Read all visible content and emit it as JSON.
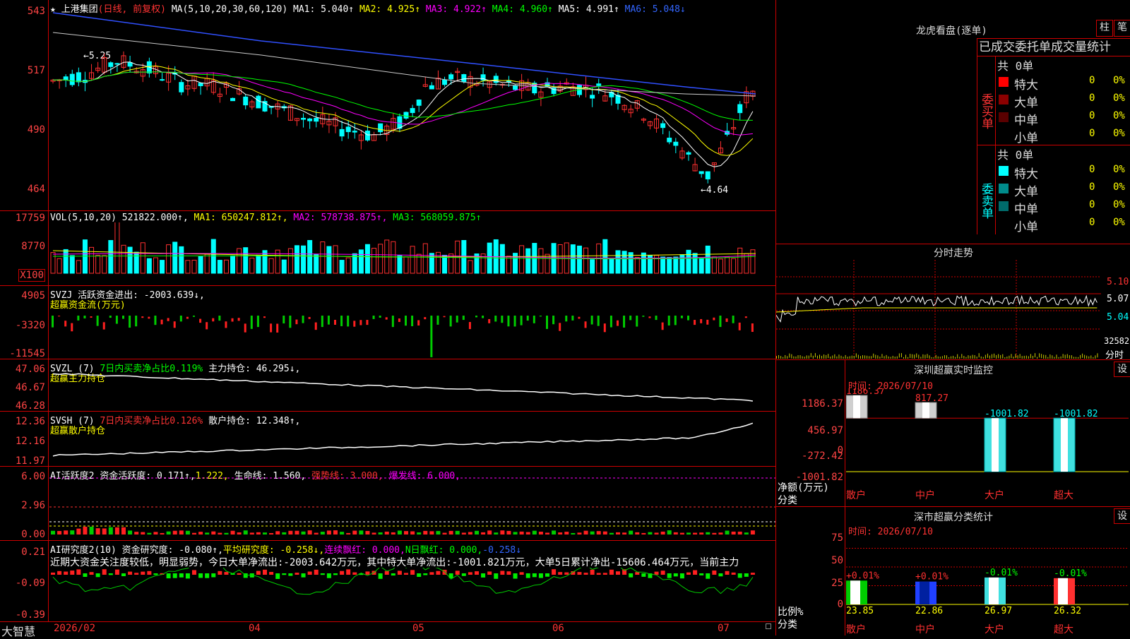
{
  "app": {
    "brand": "大智慧"
  },
  "kline": {
    "stock_name": "上港集团",
    "period_label": "(日线, 前复权)",
    "ma_params": "MA(5,10,20,30,60,120)",
    "ma_items": [
      {
        "label": "MA1: 5.040↑",
        "color": "#ffffff"
      },
      {
        "label": "MA2: 4.925↑",
        "color": "#ffff00"
      },
      {
        "label": "MA3: 4.922↑",
        "color": "#ff00ff"
      },
      {
        "label": "MA4: 4.960↑",
        "color": "#00ff00"
      },
      {
        "label": "MA5: 4.991↑",
        "color": "#ffffff"
      },
      {
        "label": "MA6: 5.048↓",
        "color": "#3366ff"
      }
    ],
    "y_ticks": [
      "543",
      "517",
      "490",
      "464"
    ],
    "high_marker": "←5.25",
    "low_marker": "←4.64"
  },
  "volume": {
    "header_name": "VOL(5,10,20)",
    "header_value": "521822.000↑,",
    "ma1": "MA1: 650247.812↑,",
    "ma2": "MA2: 578738.875↑,",
    "ma3": "MA3: 568059.875↑",
    "y_ticks": [
      "17759",
      "8770"
    ],
    "unit": "X100"
  },
  "svzj": {
    "header": "SVZJ  活跃资金进出: -2003.639↓,",
    "subtitle": "超赢资金流(万元)",
    "y_ticks": [
      "4905",
      "-3320",
      "-11545"
    ]
  },
  "svzl": {
    "name": "SVZL (7)",
    "ratio": "7日内买卖净占比0.119%",
    "hold": "主力持仓: 46.295↓,",
    "subtitle": "超赢主力持仓",
    "y_ticks": [
      "47.06",
      "46.67",
      "46.28"
    ]
  },
  "svsh": {
    "name": "SVSH (7)",
    "ratio": "7日内买卖净占比0.126%",
    "hold": "散户持仓: 12.348↑,",
    "subtitle": "超赢散户持仓",
    "y_ticks": [
      "12.36",
      "12.16",
      "11.97"
    ]
  },
  "ai_active": {
    "name": "AI活跃度2",
    "v1": "资金活跃度: 0.171↑,",
    "v2": "1.222,",
    "v3": "生命线: 1.560,",
    "v4": "强势线: 3.000,",
    "v5": "爆发线: 6.000,",
    "y_ticks": [
      "6.00",
      "2.96",
      "0.00"
    ]
  },
  "ai_research": {
    "name": "AI研究度2(10)",
    "v1": "资金研究度: -0.080↑,",
    "v2": "平均研究度: -0.258↓,",
    "v3": "连续飘红: 0.000,",
    "v4": "N日飘红: 0.000,",
    "v5": "-0.258↓",
    "commentary": "近期大资金关注度较低，明显弱势，今日大单净流出:-2003.642万元，其中特大单净流出:-1001.821万元，大单5日累计净出-15606.464万元，当前主力",
    "y_ticks": [
      "0.21",
      "-0.09",
      "-0.39"
    ]
  },
  "x_axis": {
    "labels": [
      "2026/02",
      "04",
      "05",
      "06",
      "07"
    ]
  },
  "right_panel": {
    "dragon_title": "龙虎看盘(逐单)",
    "btn_bar": "柱",
    "btn_line": "笔",
    "stats_title": "已成交委托单成交量统计",
    "buy_label": "委买单",
    "sell_label": "委卖单",
    "buy_total": "共 0单",
    "sell_total": "共 0单",
    "buy_rows": [
      {
        "label": "特大",
        "color": "#ff0000",
        "count": "0",
        "pct": "0%"
      },
      {
        "label": "大单",
        "color": "#8b0000",
        "count": "0",
        "pct": "0%"
      },
      {
        "label": "中单",
        "color": "#5a0000",
        "count": "0",
        "pct": "0%"
      },
      {
        "label": "小单",
        "color": "",
        "count": "0",
        "pct": "0%"
      }
    ],
    "sell_rows": [
      {
        "label": "特大",
        "color": "#00ffff",
        "count": "0",
        "pct": "0%"
      },
      {
        "label": "大单",
        "color": "#008b8b",
        "count": "0",
        "pct": "0%"
      },
      {
        "label": "中单",
        "color": "#006b6b",
        "count": "0",
        "pct": "0%"
      },
      {
        "label": "小单",
        "color": "",
        "count": "0",
        "pct": "0%"
      }
    ],
    "intraday_title": "分时走势",
    "intraday_ticks": [
      "5.10",
      "5.07",
      "5.04",
      "32582",
      "分时"
    ],
    "monitor_title": "深圳超赢实时监控",
    "monitor_btn": "设",
    "monitor_time": "时间: 2026/07/10",
    "monitor_y": [
      "1186.37",
      "456.97",
      "0",
      "-272.42",
      "-1001.82"
    ],
    "monitor_unit1": "净额(万元)",
    "monitor_unit2": "分类",
    "monitor_values": [
      "1186.37",
      "817.27",
      "-1001.82",
      "-1001.82"
    ],
    "categories": [
      "散户",
      "中户",
      "大户",
      "超大"
    ],
    "class_title": "深市超赢分类统计",
    "class_btn": "设",
    "class_time": "时间: 2026/07/10",
    "class_y": [
      "75",
      "50",
      "25",
      "0"
    ],
    "class_unit1": "比例%",
    "class_unit2": "分类",
    "class_changes": [
      "+0.01%",
      "+0.01%",
      "-0.01%",
      "-0.01%"
    ],
    "class_values": [
      "23.85",
      "22.86",
      "26.97",
      "26.32"
    ]
  },
  "chart_data": [
    {
      "type": "bar",
      "title": "深圳超赢实时监控",
      "ylabel": "净额(万元)",
      "categories": [
        "散户",
        "中户",
        "大户",
        "超大"
      ],
      "values": [
        1186.37,
        817.27,
        -1001.82,
        -1001.82
      ],
      "ylim": [
        -1001.82,
        1186.37
      ]
    },
    {
      "type": "bar",
      "title": "深市超赢分类统计",
      "ylabel": "比例%",
      "categories": [
        "散户",
        "中户",
        "大户",
        "超大"
      ],
      "values": [
        23.85,
        22.86,
        26.97,
        26.32
      ],
      "ylim": [
        0,
        75
      ]
    }
  ]
}
